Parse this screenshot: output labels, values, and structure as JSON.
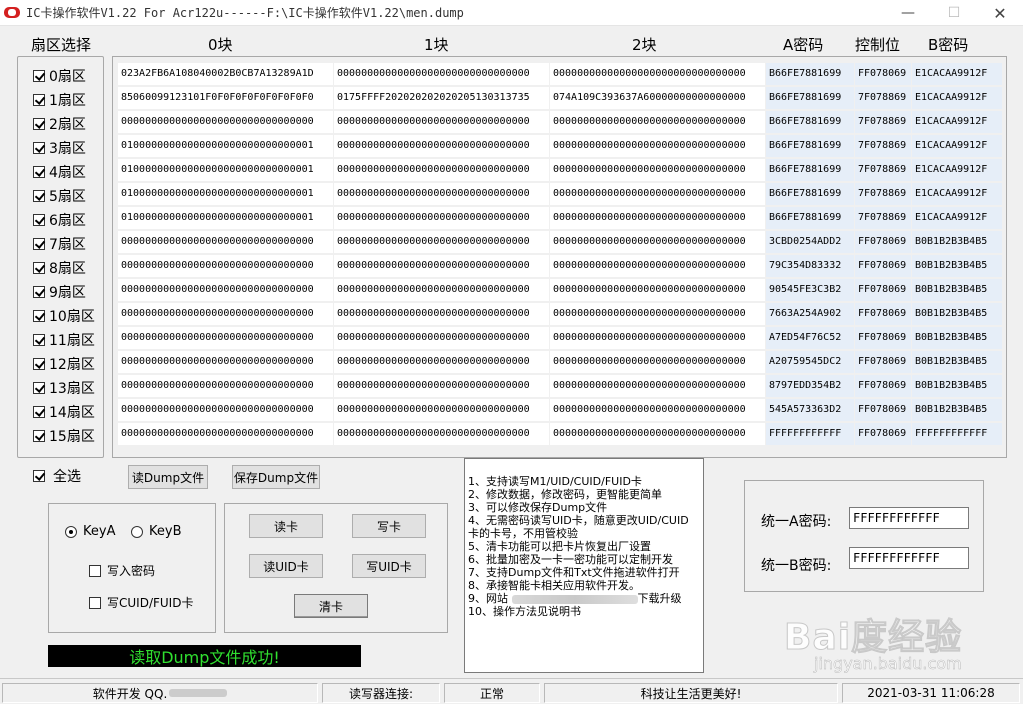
{
  "window": {
    "title": "IC卡操作软件V1.22 For Acr122u------F:\\IC卡操作软件V1.22\\men.dump",
    "minimize_glyph": "—",
    "maximize_glyph": "☐",
    "close_glyph": "✕"
  },
  "headers": {
    "sector_select": "扇区选择",
    "block0": "0块",
    "block1": "1块",
    "block2": "2块",
    "key_a": "A密码",
    "control": "控制位",
    "key_b": "B密码"
  },
  "sectors": [
    {
      "label": "0扇区",
      "checked": true,
      "b0": "023A2FB6A108040002B0CB7A13289A1D",
      "b1": "00000000000000000000000000000000",
      "b2": "00000000000000000000000000000000",
      "a": "B66FE7881699",
      "c": "FF078069",
      "b": "E1CACAA9912F"
    },
    {
      "label": "1扇区",
      "checked": true,
      "b0": "85060099123101F0F0F0F0F0F0F0F0F0",
      "b1": "0175FFFF202020202020205130313735",
      "b2": "074A109C393637A60000000000000000",
      "a": "B66FE7881699",
      "c": "7F078869",
      "b": "E1CACAA9912F"
    },
    {
      "label": "2扇区",
      "checked": true,
      "b0": "00000000000000000000000000000000",
      "b1": "00000000000000000000000000000000",
      "b2": "00000000000000000000000000000000",
      "a": "B66FE7881699",
      "c": "7F078869",
      "b": "E1CACAA9912F"
    },
    {
      "label": "3扇区",
      "checked": true,
      "b0": "01000000000000000000000000000001",
      "b1": "00000000000000000000000000000000",
      "b2": "00000000000000000000000000000000",
      "a": "B66FE7881699",
      "c": "7F078869",
      "b": "E1CACAA9912F"
    },
    {
      "label": "4扇区",
      "checked": true,
      "b0": "01000000000000000000000000000001",
      "b1": "00000000000000000000000000000000",
      "b2": "00000000000000000000000000000000",
      "a": "B66FE7881699",
      "c": "7F078869",
      "b": "E1CACAA9912F"
    },
    {
      "label": "5扇区",
      "checked": true,
      "b0": "01000000000000000000000000000001",
      "b1": "00000000000000000000000000000000",
      "b2": "00000000000000000000000000000000",
      "a": "B66FE7881699",
      "c": "7F078869",
      "b": "E1CACAA9912F"
    },
    {
      "label": "6扇区",
      "checked": true,
      "b0": "01000000000000000000000000000001",
      "b1": "00000000000000000000000000000000",
      "b2": "00000000000000000000000000000000",
      "a": "B66FE7881699",
      "c": "7F078869",
      "b": "E1CACAA9912F"
    },
    {
      "label": "7扇区",
      "checked": true,
      "b0": "00000000000000000000000000000000",
      "b1": "00000000000000000000000000000000",
      "b2": "00000000000000000000000000000000",
      "a": "3CBD0254ADD2",
      "c": "FF078069",
      "b": "B0B1B2B3B4B5"
    },
    {
      "label": "8扇区",
      "checked": true,
      "b0": "00000000000000000000000000000000",
      "b1": "00000000000000000000000000000000",
      "b2": "00000000000000000000000000000000",
      "a": "79C354D83332",
      "c": "FF078069",
      "b": "B0B1B2B3B4B5"
    },
    {
      "label": "9扇区",
      "checked": true,
      "b0": "00000000000000000000000000000000",
      "b1": "00000000000000000000000000000000",
      "b2": "00000000000000000000000000000000",
      "a": "90545FE3C3B2",
      "c": "FF078069",
      "b": "B0B1B2B3B4B5"
    },
    {
      "label": "10扇区",
      "checked": true,
      "b0": "00000000000000000000000000000000",
      "b1": "00000000000000000000000000000000",
      "b2": "00000000000000000000000000000000",
      "a": "7663A254A902",
      "c": "FF078069",
      "b": "B0B1B2B3B4B5"
    },
    {
      "label": "11扇区",
      "checked": true,
      "b0": "00000000000000000000000000000000",
      "b1": "00000000000000000000000000000000",
      "b2": "00000000000000000000000000000000",
      "a": "A7ED54F76C52",
      "c": "FF078069",
      "b": "B0B1B2B3B4B5"
    },
    {
      "label": "12扇区",
      "checked": true,
      "b0": "00000000000000000000000000000000",
      "b1": "00000000000000000000000000000000",
      "b2": "00000000000000000000000000000000",
      "a": "A20759545DC2",
      "c": "FF078069",
      "b": "B0B1B2B3B4B5"
    },
    {
      "label": "13扇区",
      "checked": true,
      "b0": "00000000000000000000000000000000",
      "b1": "00000000000000000000000000000000",
      "b2": "00000000000000000000000000000000",
      "a": "8797EDD354B2",
      "c": "FF078069",
      "b": "B0B1B2B3B4B5"
    },
    {
      "label": "14扇区",
      "checked": true,
      "b0": "00000000000000000000000000000000",
      "b1": "00000000000000000000000000000000",
      "b2": "00000000000000000000000000000000",
      "a": "545A573363D2",
      "c": "FF078069",
      "b": "B0B1B2B3B4B5"
    },
    {
      "label": "15扇区",
      "checked": true,
      "b0": "00000000000000000000000000000000",
      "b1": "00000000000000000000000000000000",
      "b2": "00000000000000000000000000000000",
      "a": "FFFFFFFFFFFF",
      "c": "FF078069",
      "b": "FFFFFFFFFFFF"
    }
  ],
  "select_all": {
    "label": "全选",
    "checked": true
  },
  "file_buttons": {
    "read_dump": "读Dump文件",
    "save_dump": "保存Dump文件"
  },
  "key_options": {
    "key_a": "KeyA",
    "key_b": "KeyB",
    "selected": "KeyA",
    "write_password": "写入密码",
    "write_cuid": "写CUID/FUID卡"
  },
  "actions": {
    "read_card": "读卡",
    "write_card": "写卡",
    "read_uid": "读UID卡",
    "write_uid": "写UID卡",
    "clear_card": "清卡"
  },
  "status_message": "读取Dump文件成功!",
  "info_lines": [
    "1、支持读写M1/UID/CUID/FUID卡",
    "2、修改数据，修改密码，更智能更简单",
    "3、可以修改保存Dump文件",
    "4、无需密码读写UID卡，随意更改UID/CUID",
    "   卡的卡号，不用管校验",
    "5、清卡功能可以把卡片恢复出厂设置",
    "6、批量加密及一卡一密功能可以定制开发",
    "7、支持Dump文件和Txt文件拖进软件打开",
    "8、承接智能卡相关应用软件开发。"
  ],
  "info_website": {
    "prefix": "9、网站",
    "suffix": "下载升级"
  },
  "info_last": "10、操作方法见说明书",
  "unified": {
    "a_label": "统一A密码:",
    "a_value": "FFFFFFFFFFFF",
    "b_label": "统一B密码:",
    "b_value": "FFFFFFFFFFFF"
  },
  "statusbar": {
    "developer": "软件开发   QQ.",
    "reader_label": "读写器连接:",
    "reader_state": "正常",
    "slogan": "科技让生活更美好!",
    "datetime": "2021-03-31 11:06:28"
  },
  "watermark": {
    "text": "Bai度经验",
    "sub": "jingyan.baidu.com"
  }
}
